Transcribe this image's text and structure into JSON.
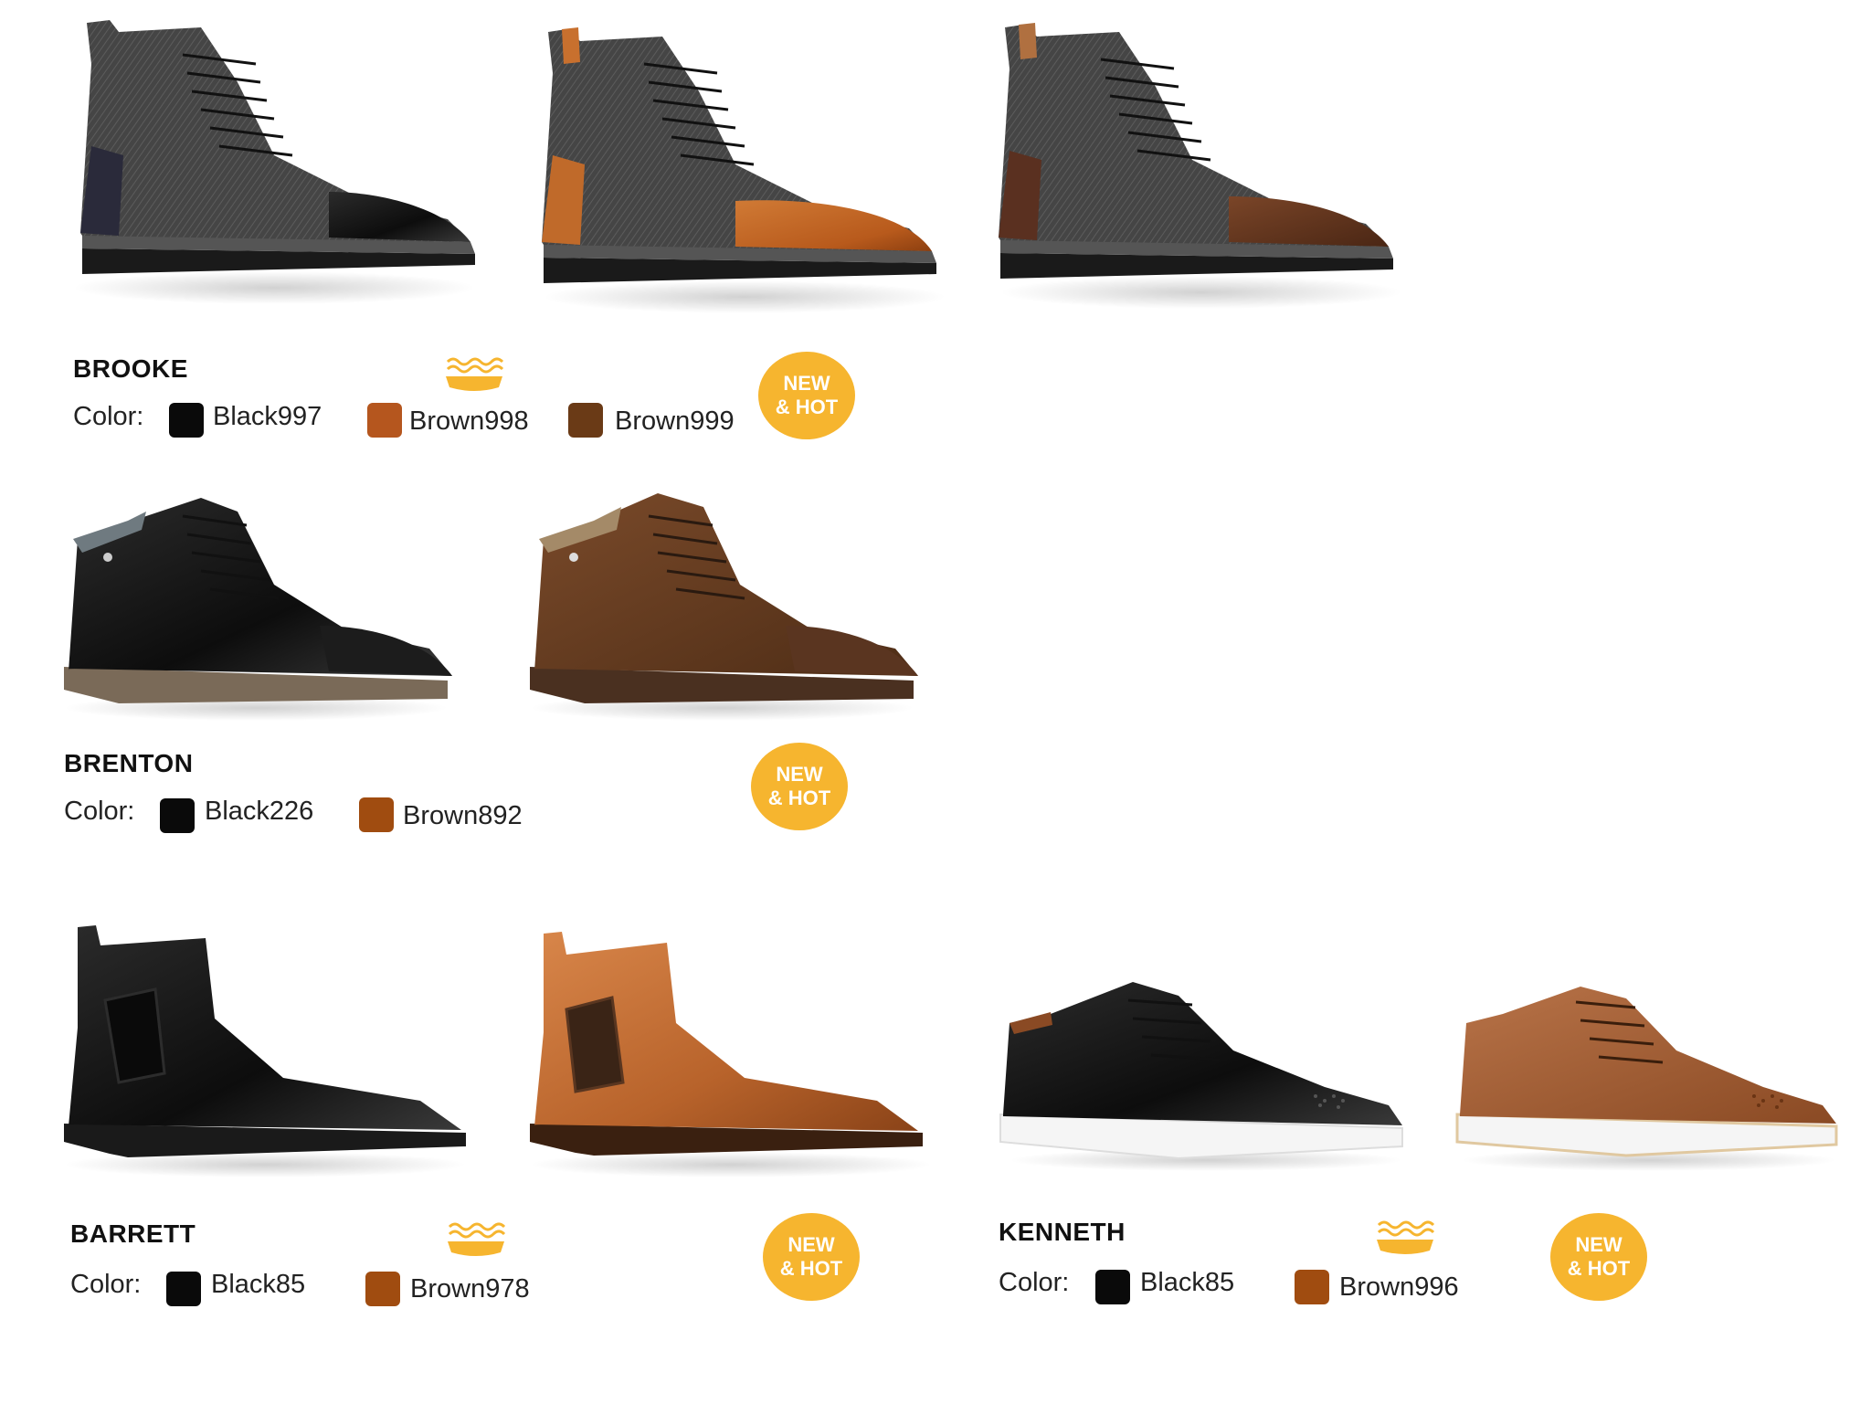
{
  "colors": {
    "badge": "#f6b52f",
    "black": "#0a0a0a",
    "brown_cognac": "#b5561e",
    "brown_dark": "#6a3a16",
    "brown_medium": "#a04c10"
  },
  "icons": {
    "sole": "cushioned-insole-icon"
  },
  "products": [
    {
      "name": "BROOKE",
      "color_label": "Color:",
      "badge": {
        "line1": "NEW",
        "line2": "& HOT"
      },
      "swatches": [
        {
          "label": "Black997",
          "color": "#0a0a0a"
        },
        {
          "label": "Brown998",
          "color": "#b5561e"
        },
        {
          "label": "Brown999",
          "color": "#6a3a16"
        }
      ]
    },
    {
      "name": "BRENTON",
      "color_label": "Color:",
      "badge": {
        "line1": "NEW",
        "line2": "& HOT"
      },
      "swatches": [
        {
          "label": "Black226",
          "color": "#0a0a0a"
        },
        {
          "label": "Brown892",
          "color": "#a04c10"
        }
      ]
    },
    {
      "name": "BARRETT",
      "color_label": "Color:",
      "badge": {
        "line1": "NEW",
        "line2": "& HOT"
      },
      "swatches": [
        {
          "label": "Black85",
          "color": "#0a0a0a"
        },
        {
          "label": "Brown978",
          "color": "#a04c10"
        }
      ]
    },
    {
      "name": "KENNETH",
      "color_label": "Color:",
      "badge": {
        "line1": "NEW",
        "line2": "& HOT"
      },
      "swatches": [
        {
          "label": "Black85",
          "color": "#0a0a0a"
        },
        {
          "label": "Brown996",
          "color": "#a04c10"
        }
      ]
    }
  ]
}
